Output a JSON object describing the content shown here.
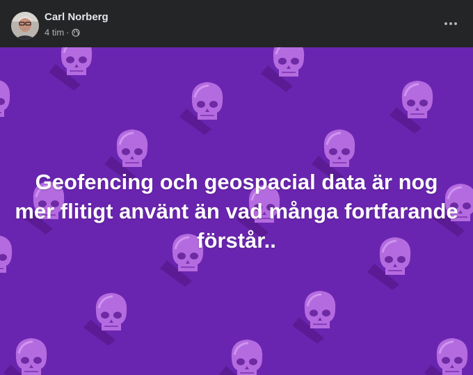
{
  "post": {
    "author": {
      "name": "Carl Norberg",
      "avatar_icon": "profile-photo"
    },
    "timestamp": "4 tim",
    "separator": "·",
    "audience_icon": "globe-icon",
    "more_icon": "more-options-icon",
    "background_color": "#6a25b0",
    "background_motif": "skull-pattern",
    "text": "Geofencing och geospacial data är nog mer flitigt använt än vad många fortfarande förstår.."
  }
}
